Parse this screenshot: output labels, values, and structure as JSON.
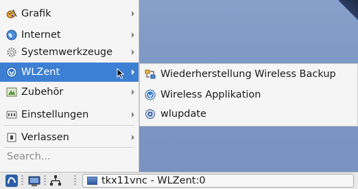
{
  "menu": {
    "items": [
      {
        "label": "Grafik",
        "icon": "graphics-icon"
      },
      {
        "label": "Internet",
        "icon": "internet-globe-icon"
      },
      {
        "label": "Systemwerkzeuge",
        "icon": "system-gear-icon"
      },
      {
        "label": "WLZent",
        "icon": "wlzent-icon",
        "active": true
      },
      {
        "label": "Zubehör",
        "icon": "accessories-icon"
      },
      {
        "label": "Einstellungen",
        "icon": "settings-icon"
      },
      {
        "label": "Verlassen",
        "icon": "logout-icon"
      }
    ],
    "search_placeholder": "Search..."
  },
  "submenu": {
    "items": [
      {
        "label": "Wiederherstellung Wireless Backup",
        "icon": "restore-icon"
      },
      {
        "label": "Wireless Applikation",
        "icon": "wlzent-icon"
      },
      {
        "label": "wlupdate",
        "icon": "update-icon"
      }
    ]
  },
  "taskbar": {
    "task_label": "tkx11vnc - WLZent:0"
  },
  "colors": {
    "highlight": "#3d80d3",
    "desktop": "#7f9ac6",
    "menu_bg": "#f5f5f5"
  }
}
